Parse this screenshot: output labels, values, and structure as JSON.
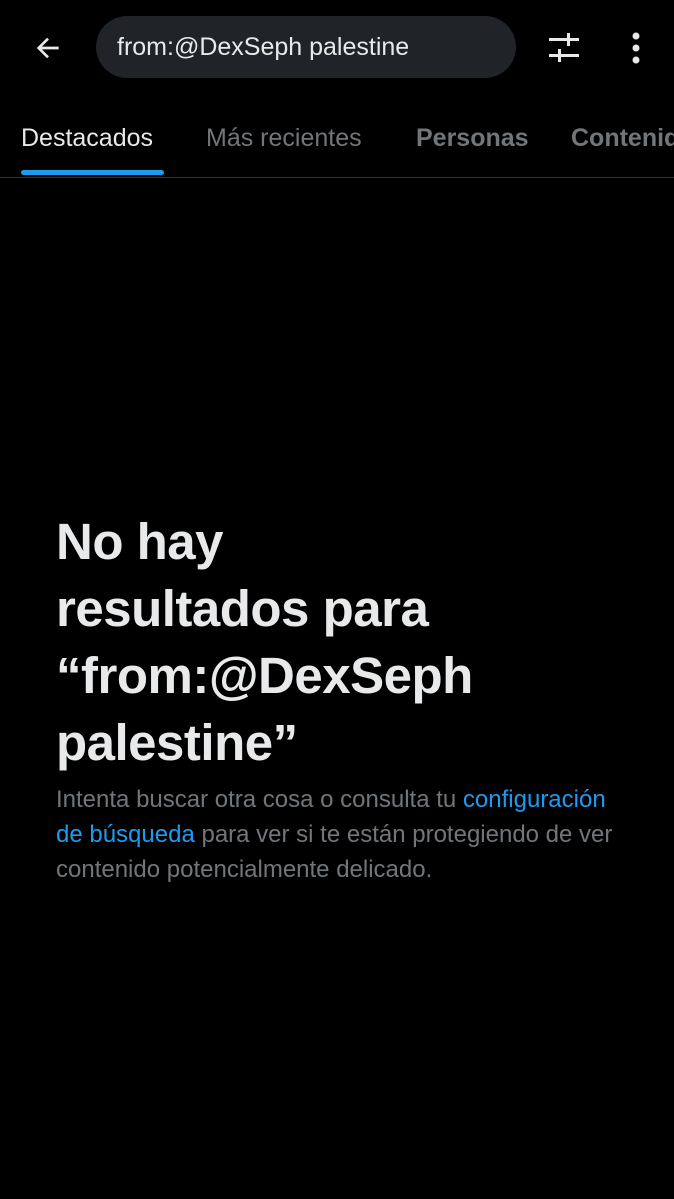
{
  "search": {
    "value": "from:@DexSeph palestine"
  },
  "icons": {
    "back": "arrow-left-icon",
    "filter": "sliders-icon",
    "more": "vertical-ellipsis-icon"
  },
  "tabs": [
    {
      "label": "Destacados",
      "active": true
    },
    {
      "label": "Más recientes",
      "active": false
    },
    {
      "label": "Personas",
      "active": false
    },
    {
      "label": "Contenido",
      "active": false
    }
  ],
  "empty_state": {
    "title_line1": "No hay",
    "title_line2": "resultados para",
    "title_line3": "“from:@DexSeph",
    "title_line4": "palestine”",
    "body_before_link": "Intenta buscar otra cosa o consulta tu ",
    "link_text": "configuración de búsqueda",
    "body_after_link": " para ver si te están protegiendo de ver contenido potencialmente delicado."
  },
  "colors": {
    "background": "#000000",
    "accent": "#1d9bf0",
    "text_primary": "#e7e9ea",
    "text_secondary": "#71767b",
    "search_bg": "#202327"
  }
}
